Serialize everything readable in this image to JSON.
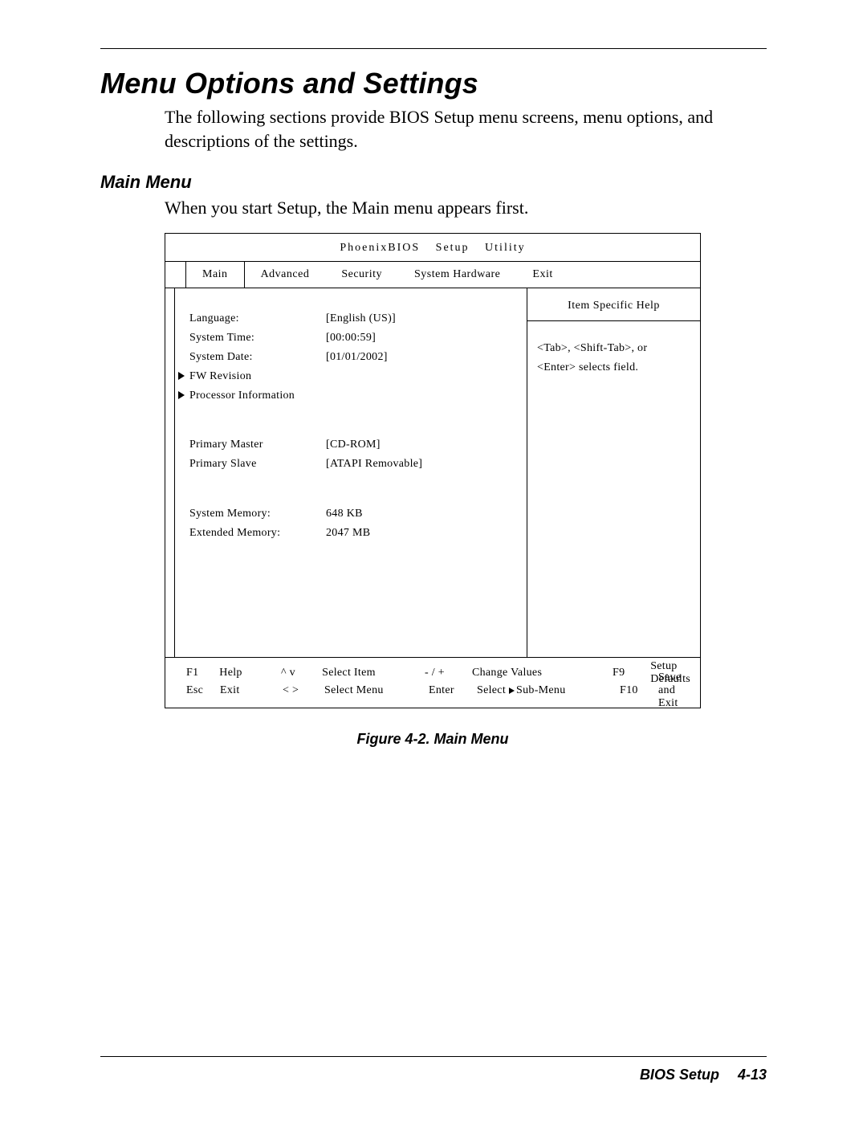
{
  "doc": {
    "heading": "Menu Options and Settings",
    "intro": "The following sections provide BIOS Setup menu screens, menu options, and descriptions of the settings.",
    "subheading": "Main Menu",
    "subtext": "When you start Setup, the Main menu appears first.",
    "figcap": "Figure 4-2.  Main Menu",
    "footer_title": "BIOS Setup",
    "footer_page": "4-13"
  },
  "bios": {
    "title": "PhoenixBIOS    Setup    Utility",
    "tabs": [
      "Main",
      "Advanced",
      "Security",
      "System Hardware",
      "Exit"
    ],
    "help_title": "Item Specific Help",
    "help_line1": "<Tab>, <Shift-Tab>, or",
    "help_line2": "<Enter> selects field.",
    "fields": {
      "language_label": "Language:",
      "language_value": "[English   (US)]",
      "time_label": "System Time:",
      "time_value": "[00:00:59]",
      "date_label": "System Date:",
      "date_value": "[01/01/2002]",
      "fw_label": "FW Revision",
      "proc_label": "Processor Information",
      "pm_label": "Primary Master",
      "pm_value": "[CD-ROM]",
      "ps_label": "Primary Slave",
      "ps_value": "[ATAPI Removable]",
      "sysmem_label": "System Memory:",
      "sysmem_value": "648 KB",
      "extmem_label": "Extended Memory:",
      "extmem_value": "2047 MB"
    },
    "footer": {
      "r1": {
        "k1": "F1",
        "l1": "Help",
        "k2": "^  v",
        "l2": "Select Item",
        "k3": "- / +",
        "l3": "Change Values",
        "k4": "F9",
        "l4": "Setup Defaults"
      },
      "r2": {
        "k1": "Esc",
        "l1": "Exit",
        "k2": "<   >",
        "l2": "Select Menu",
        "k3": "Enter",
        "l3a": "Select ",
        "l3b": "Sub-Menu",
        "k4": "F10",
        "l4": "Save and Exit"
      }
    }
  }
}
